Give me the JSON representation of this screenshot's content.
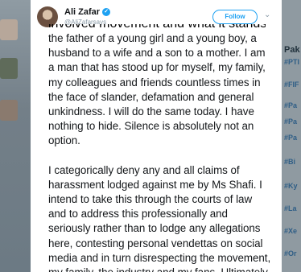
{
  "profile": {
    "name": "Ali Zafar",
    "handle": "@AliZafarsays"
  },
  "actions": {
    "follow_label": "Follow",
    "menu_icon": "chevron-down-icon"
  },
  "tweet": {
    "top_cut_line": "involved movement and what it stands for. I am",
    "lines": [
      "the father of a young girl and a young boy, a",
      "husband to a wife and a son to a mother. I am",
      "a man that has stood up for myself, my family,",
      "my colleagues and friends countless times in",
      "the face of slander, defamation and general",
      "unkindness. I will do the same today. I have",
      "nothing to hide. Silence is absolutely not an",
      "option.",
      "",
      "I categorically deny any and all claims of",
      "harassment lodged against me by Ms Shafi. I",
      "intend to take this through the courts of law",
      "and to address this professionally and",
      "seriously rather than to lodge any allegations",
      "here, contesting personal vendettas on social",
      "media and in turn disrespecting the movement,",
      "my family, the industry and my fans. Ultimately"
    ]
  },
  "background": {
    "right_stubs": [
      "Pak",
      "#PTI",
      "#FIF",
      "#Pa",
      "#Pa",
      "#Pa",
      "#Bi",
      "#Ky",
      "#La",
      "#Xe",
      "#Or"
    ]
  },
  "colors": {
    "accent": "#1da1f2",
    "text": "#14171a",
    "muted": "#8899a6"
  }
}
